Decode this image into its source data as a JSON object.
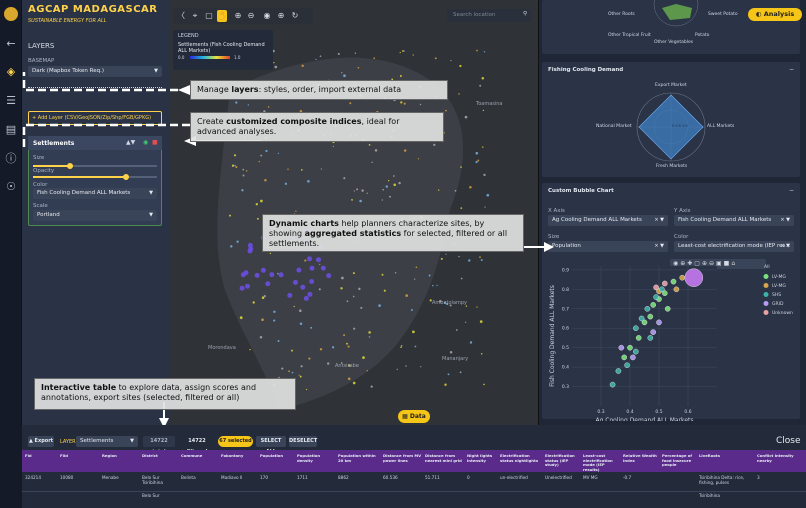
{
  "app": {
    "title": "AGCAP MADAGASCAR",
    "subtitle": "SUSTAINABLE ENERGY FOR ALL"
  },
  "rail": {
    "icons": [
      "logo-icon",
      "back-arrow-icon",
      "layers-icon",
      "sliders-icon",
      "clipboard-icon",
      "info-icon",
      "globe-icon",
      "save-icon",
      "folder-icon"
    ]
  },
  "left": {
    "layers_heading": "LAYERS",
    "basemap_label": "BASEMAP",
    "basemap_value": "Dark (Mapbox Token Req.)",
    "add_layer": "+ Add Layer (CSV/GeoJSON/Zip/Shp/FGB/GPKG)",
    "layer_title": "Settlements",
    "size_label": "Size",
    "opacity_label": "Opacity",
    "color_label": "Color",
    "color_value": "Fish Cooling Demand ALL Markets",
    "scale_label": "Scale",
    "scale_value": "Portland",
    "size_level": 0.3,
    "opacity_level": 0.75
  },
  "map": {
    "legend_title": "LEGEND",
    "legend_layer": "Settlements (Fish Cooling Demand ALL Markets)",
    "legend_min": "0.0",
    "legend_max": "1.0",
    "search_placeholder": "Search location",
    "place_labels": [
      "Toamasina",
      "Ambatolampy",
      "Morondava",
      "Antsirabe",
      "Mananjary"
    ],
    "data_button": "Data"
  },
  "right": {
    "analysis_button": "Analysis",
    "top_radar_labels": [
      "Other Roots",
      "Sweet Potato",
      "Other Tropical Fruit",
      "Potato",
      "Other Vegetables"
    ],
    "fishing_title": "Fishing Cooling Demand",
    "fishing_labels": [
      "Export Market",
      "National Market",
      "ALL Markets",
      "Fresh Markets"
    ],
    "fishing_ticks": "0 0.5 1.0",
    "bubble_title": "Custom Bubble Chart",
    "x_axis_label": "X Axis",
    "x_axis_value": "Ag Cooling Demand ALL Markets",
    "y_axis_label": "Y Axis",
    "y_axis_value": "Fish Cooling Demand ALL Markets",
    "size_label": "Size",
    "size_value": "Population",
    "color_label": "Color",
    "color_value": "Least-cost electrification mode (IEP res..."
  },
  "chart_data": {
    "type": "scatter",
    "title": "",
    "xlabel": "Ag Cooling Demand ALL Markets",
    "ylabel": "Fish Cooling Demand ALL Markets",
    "xlim": [
      0.2,
      0.7
    ],
    "ylim": [
      0.2,
      0.92
    ],
    "xticks": [
      "0.3",
      "0.4",
      "0.5",
      "0.6"
    ],
    "yticks": [
      "0.3",
      "0.4",
      "0.5",
      "0.6",
      "0.7",
      "0.8",
      "0.9"
    ],
    "legend_title": "All",
    "series": [
      {
        "name": "LV-MG",
        "color": "#7be07b",
        "points": [
          [
            0.55,
            0.84
          ],
          [
            0.52,
            0.78
          ],
          [
            0.5,
            0.75
          ],
          [
            0.48,
            0.72
          ],
          [
            0.53,
            0.7
          ],
          [
            0.47,
            0.66
          ],
          [
            0.45,
            0.63
          ],
          [
            0.43,
            0.55
          ],
          [
            0.4,
            0.5
          ],
          [
            0.38,
            0.45
          ]
        ]
      },
      {
        "name": "LV-MG",
        "color": "#d7a64a",
        "points": [
          [
            0.58,
            0.86
          ],
          [
            0.5,
            0.79
          ],
          [
            0.56,
            0.8
          ]
        ]
      },
      {
        "name": "SHS",
        "color": "#3db2a8",
        "points": [
          [
            0.51,
            0.8
          ],
          [
            0.49,
            0.76
          ],
          [
            0.46,
            0.7
          ],
          [
            0.44,
            0.65
          ],
          [
            0.42,
            0.6
          ],
          [
            0.47,
            0.55
          ],
          [
            0.36,
            0.38
          ],
          [
            0.34,
            0.31
          ],
          [
            0.39,
            0.41
          ],
          [
            0.42,
            0.48
          ]
        ]
      },
      {
        "name": "GRID",
        "color": "#b49cf2",
        "points": [
          [
            0.41,
            0.45
          ],
          [
            0.37,
            0.5
          ],
          [
            0.48,
            0.58
          ],
          [
            0.5,
            0.63
          ]
        ]
      },
      {
        "name": "Unknown",
        "color": "#e9a1a8",
        "points": [
          [
            0.52,
            0.83
          ],
          [
            0.49,
            0.81
          ]
        ]
      },
      {
        "name": "",
        "color": "#c679f2",
        "points": [
          [
            0.62,
            0.86
          ]
        ]
      }
    ]
  },
  "annotations": {
    "layers": {
      "pre": "Manage ",
      "bold": "layers",
      "post": ": styles, order, import external data"
    },
    "indices": {
      "pre": "Create ",
      "bold": "customized composite indices",
      "post": ", ideal for advanced analyses."
    },
    "charts": {
      "bold1": "Dynamic charts",
      "mid": " help planners characterize sites, by showing ",
      "bold2": "aggregated statistics",
      "post": " for selected, filtered or all settlements."
    },
    "table": {
      "bold": "Interactive table",
      "post": " to explore data, assign scores and annotations, export sites (selected, filtered or all)"
    }
  },
  "table": {
    "export": "Export",
    "layer_label": "LAYER",
    "layer_value": "Settlements",
    "total": "14722 total",
    "filtered": "14722 filtered",
    "selected": "67 selected",
    "select_all": "SELECT ALL",
    "deselect": "DESELECT",
    "close": "Close",
    "columns": [
      "Fid",
      "Fild",
      "Region",
      "District",
      "Commune",
      "Fokontany",
      "Population",
      "Population density",
      "Population within 20 km",
      "Distance from MV power lines",
      "Distance from nearest mini grid",
      "Night lights intensity",
      "Electrification status nightlights",
      "Electrification status (IEP study)",
      "Least-cost electrification mode (IEP results)",
      "Relative Wealth Index",
      "Percentage of food insecure people",
      "LiveRoots",
      "Conflict Intensity nearby"
    ],
    "rows": [
      [
        "324214",
        "10080",
        "Menabe",
        "Belo Sur Tsiribihina",
        "Belinta",
        "Madiavo II",
        "170",
        "1711",
        "8862",
        "60.536",
        "51.711",
        "0",
        "un-electrified",
        "Unelectrified",
        "MV MG",
        "-0.7",
        "",
        "Tsiribihina Delta: rice, fishing, pulses",
        "3"
      ],
      [
        "",
        "",
        "",
        "Belo Sur",
        "",
        "",
        "",
        "",
        "",
        "",
        "",
        "",
        "",
        "",
        "",
        "",
        "",
        "Tsiribihina",
        ""
      ]
    ]
  }
}
